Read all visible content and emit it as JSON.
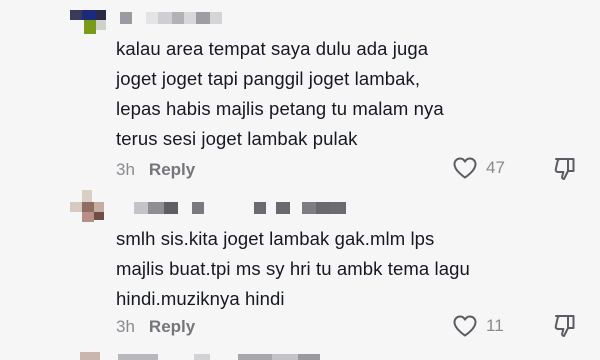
{
  "comments": [
    {
      "text_lines": [
        "kalau area tempat saya dulu ada juga",
        "joget joget tapi panggil joget lambak,",
        "lepas habis majlis petang tu malam nya",
        "terus sesi joget lambak pulak"
      ],
      "time": "3h",
      "reply_label": "Reply",
      "likes": "47"
    },
    {
      "text_lines": [
        "smlh sis.kita joget lambak gak.mlm lps",
        "majlis buat.tpi ms sy hri tu ambk tema lagu",
        "hindi.muziknya hindi"
      ],
      "time": "3h",
      "reply_label": "Reply",
      "likes": "11"
    }
  ],
  "icons": {
    "like": "heart-outline-icon",
    "dislike": "thumbs-down-outline-icon"
  },
  "colors": {
    "background": "#f6f6f6",
    "text": "#161823",
    "muted": "#8a8b91"
  }
}
